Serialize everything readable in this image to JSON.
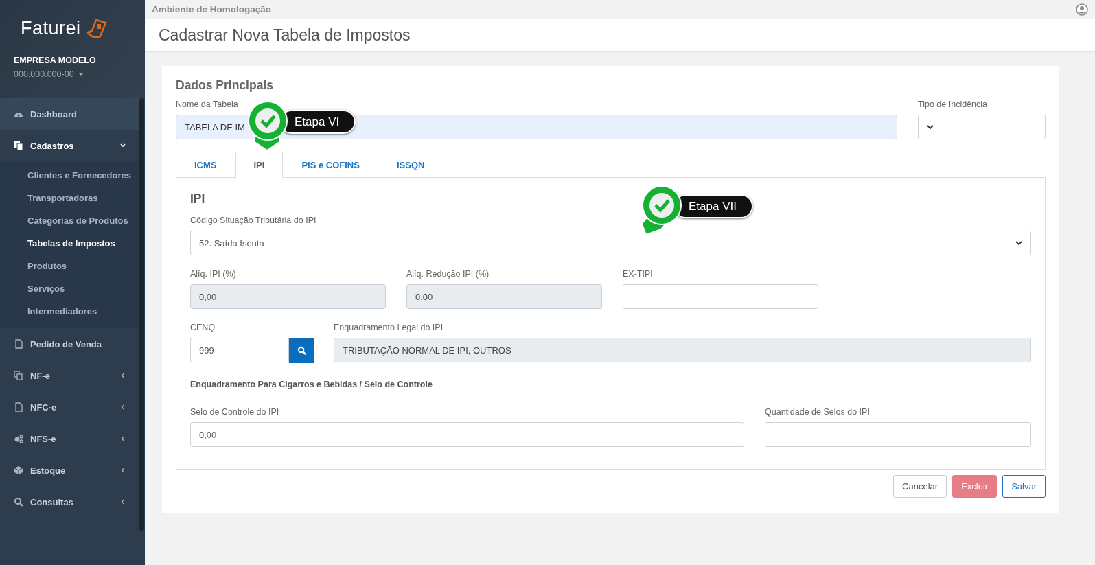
{
  "sidebar": {
    "logo": "Faturei",
    "company": "EMPRESA MODELO",
    "document": "000.000.000-00",
    "items": [
      {
        "label": "Dashboard",
        "hovered": true
      },
      {
        "label": "Cadastros",
        "expanded": true,
        "children": [
          {
            "label": "Clientes e Fornecedores",
            "selected": false
          },
          {
            "label": "Transportadoras",
            "selected": false
          },
          {
            "label": "Categorias de Produtos",
            "selected": false
          },
          {
            "label": "Tabelas de Impostos",
            "selected": true
          },
          {
            "label": "Produtos",
            "selected": false
          },
          {
            "label": "Serviços",
            "selected": false
          },
          {
            "label": "Intermediadores",
            "selected": false
          }
        ]
      },
      {
        "label": "Pedido de Venda",
        "hovered": false
      },
      {
        "label": "NF-e",
        "expanded": false
      },
      {
        "label": "NFC-e",
        "expanded": false
      },
      {
        "label": "NFS-e",
        "expanded": false
      },
      {
        "label": "Estoque",
        "expanded": false
      },
      {
        "label": "Consultas",
        "expanded": false
      }
    ]
  },
  "top_bar": {
    "environment": "Ambiente de Homologação"
  },
  "page_title": "Cadastrar Nova Tabela de Impostos",
  "form": {
    "section_title": "Dados Principais",
    "table_name": {
      "label": "Nome da Tabela",
      "value": "TABELA DE IM"
    },
    "incidence_type": {
      "label": "Tipo de Incidência"
    },
    "tabs": [
      {
        "label": "ICMS",
        "selected": false
      },
      {
        "label": "IPI",
        "selected": true
      },
      {
        "label": "PIS e COFINS",
        "selected": false
      },
      {
        "label": "ISSQN",
        "selected": false
      }
    ],
    "panel": {
      "title": "IPI",
      "cst": {
        "label": "Código Situação Tributária do IPI",
        "value": "52. Saída Isenta"
      },
      "rates": [
        {
          "label": "Alíq. IPI (%)",
          "value": "0,00",
          "disabled": true
        },
        {
          "label": "Alíq. Redução IPI (%)",
          "value": "0,00",
          "disabled": true
        },
        {
          "label": "EX-TIPI",
          "disabled": false
        }
      ],
      "cenq": {
        "label": "CENQ",
        "value": "999"
      },
      "legal": {
        "label": "Enquadramento Legal do IPI",
        "value": "TRIBUTAÇÃO NORMAL DE IPI, OUTROS",
        "disabled": true
      },
      "subheading": "Enquadramento Para Cigarros e Bebidas / Selo de Controle",
      "seal": {
        "label": "Selo de Controle do IPI",
        "value": "0,00"
      },
      "seal_qty": {
        "label": "Quantidade de Selos do IPI"
      }
    },
    "buttons": [
      {
        "label": "Cancelar",
        "kind": "default"
      },
      {
        "label": "Excluir",
        "kind": "danger"
      },
      {
        "label": "Salvar",
        "kind": "primary"
      }
    ]
  },
  "step_markers": [
    {
      "label": "Etapa VI",
      "kind": "down"
    },
    {
      "label": "Etapa VII",
      "kind": "left"
    }
  ]
}
